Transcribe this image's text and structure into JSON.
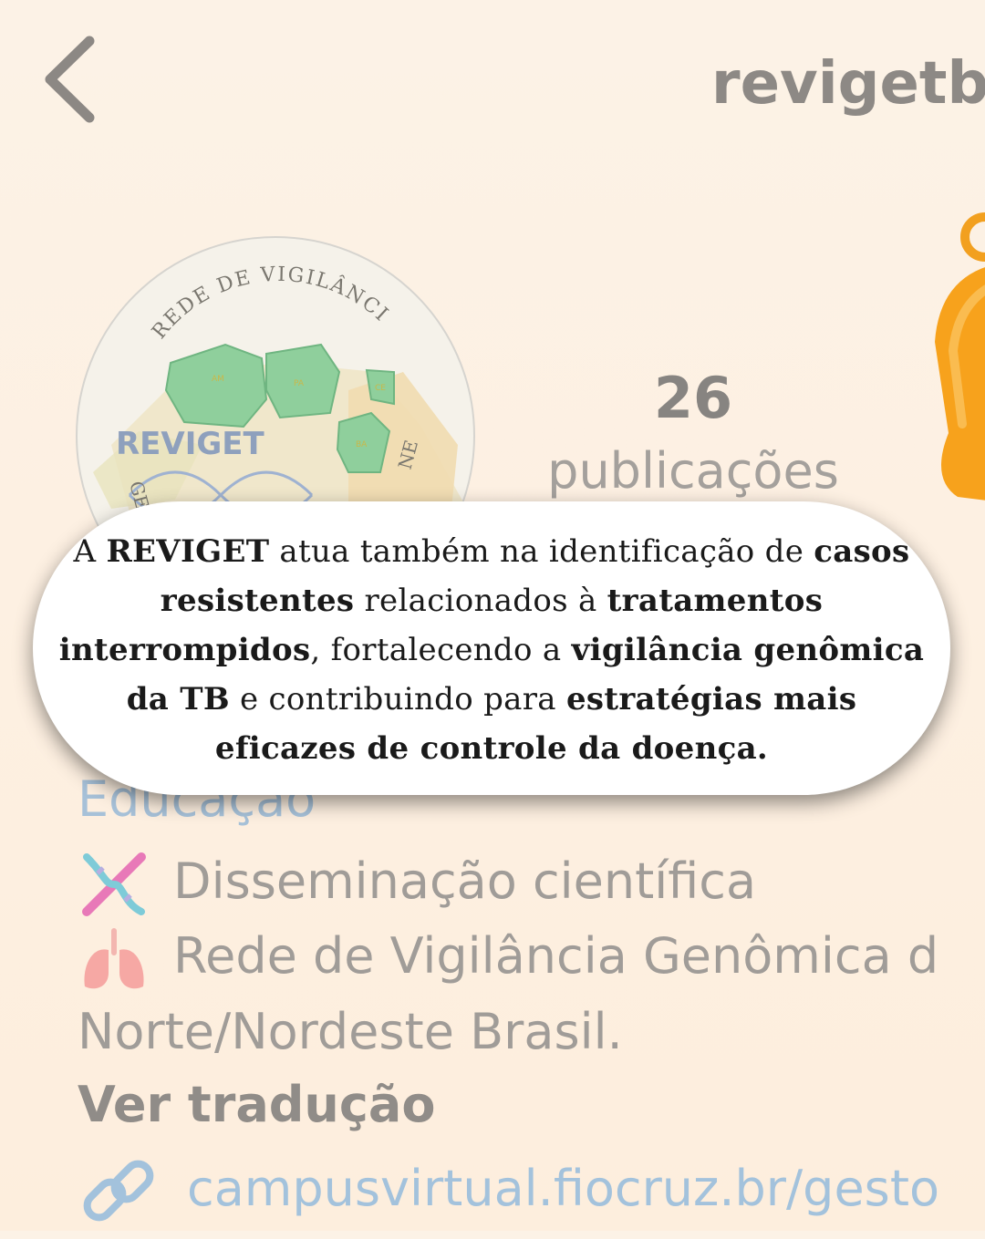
{
  "header": {
    "username": "revigetbr"
  },
  "profile": {
    "avatar_text": {
      "arc_top": "REDE DE VIGILÂNCIA",
      "brand": "REVIGET",
      "arc_left": "GENÔMICA",
      "arc_right": "NE",
      "states": [
        "AM",
        "PA",
        "CE",
        "BA"
      ]
    },
    "stats": {
      "count": "26",
      "label": "publicações"
    }
  },
  "callout": {
    "segments": [
      {
        "text": "A ",
        "bold": false
      },
      {
        "text": "REVIGET",
        "bold": true
      },
      {
        "text": " atua também na identificação de ",
        "bold": false
      },
      {
        "text": "casos resistentes",
        "bold": true
      },
      {
        "text": " relacionados à ",
        "bold": false
      },
      {
        "text": "tratamentos interrompidos",
        "bold": true
      },
      {
        "text": ", fortalecendo a ",
        "bold": false
      },
      {
        "text": "vigilância genômica da TB",
        "bold": true
      },
      {
        "text": " e contribuindo para ",
        "bold": false
      },
      {
        "text": "estratégias mais eficazes de controle da doença.",
        "bold": true
      }
    ]
  },
  "bio": {
    "category": "Educação",
    "line_dna": "Disseminação científica",
    "line_lungs": "Rede de Vigilância Genômica d",
    "line_wrap": "Norte/Nordeste Brasil.",
    "translate_label": "Ver tradução",
    "link": "campusvirtual.fiocruz.br/gesto"
  },
  "icons": {
    "back": "chevron-left-icon",
    "bell": "bell-icon",
    "dna": "dna-emoji-icon",
    "lungs": "lungs-emoji-icon",
    "link": "link-icon"
  },
  "colors": {
    "background": "#fcf2e6",
    "link_blue": "#a3c2dc",
    "map_green": "#8fcf9c",
    "bell_orange": "#f7a21c"
  }
}
